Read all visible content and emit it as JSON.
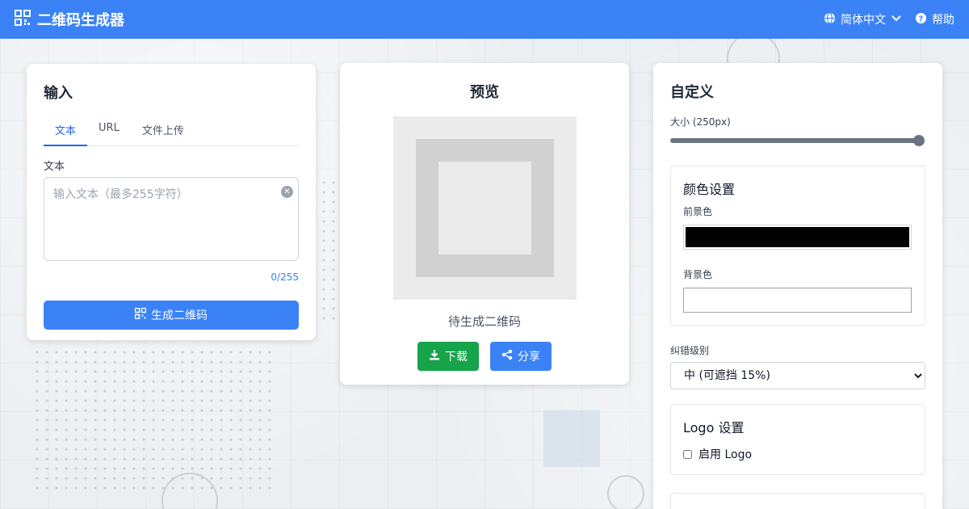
{
  "header": {
    "title": "二维码生成器",
    "language": "简体中文",
    "help": "帮助"
  },
  "input_card": {
    "title": "输入",
    "tabs": [
      "文本",
      "URL",
      "文件上传"
    ],
    "active_tab": "文本",
    "field_label": "文本",
    "placeholder": "输入文本（最多255字符）",
    "value": "",
    "counter": "0/255",
    "generate_label": "生成二维码"
  },
  "preview_card": {
    "title": "预览",
    "status": "待生成二维码",
    "download_label": "下载",
    "share_label": "分享"
  },
  "custom_card": {
    "title": "自定义",
    "size_label": "大小 (250px)",
    "size_level": 1.0,
    "color_section": {
      "title": "颜色设置",
      "foreground_label": "前景色",
      "foreground_color": "#000000",
      "background_label": "背景色",
      "background_color": "#ffffff"
    },
    "error_level_label": "纠错级别",
    "error_level_value": "中 (可遮挡 15%)",
    "logo_section": {
      "title": "Logo 设置",
      "enable_label": "启用 Logo",
      "enabled": false
    }
  },
  "colors": {
    "header": "#3b82f6",
    "primary": "#3b82f6",
    "download": "#16a34a"
  }
}
